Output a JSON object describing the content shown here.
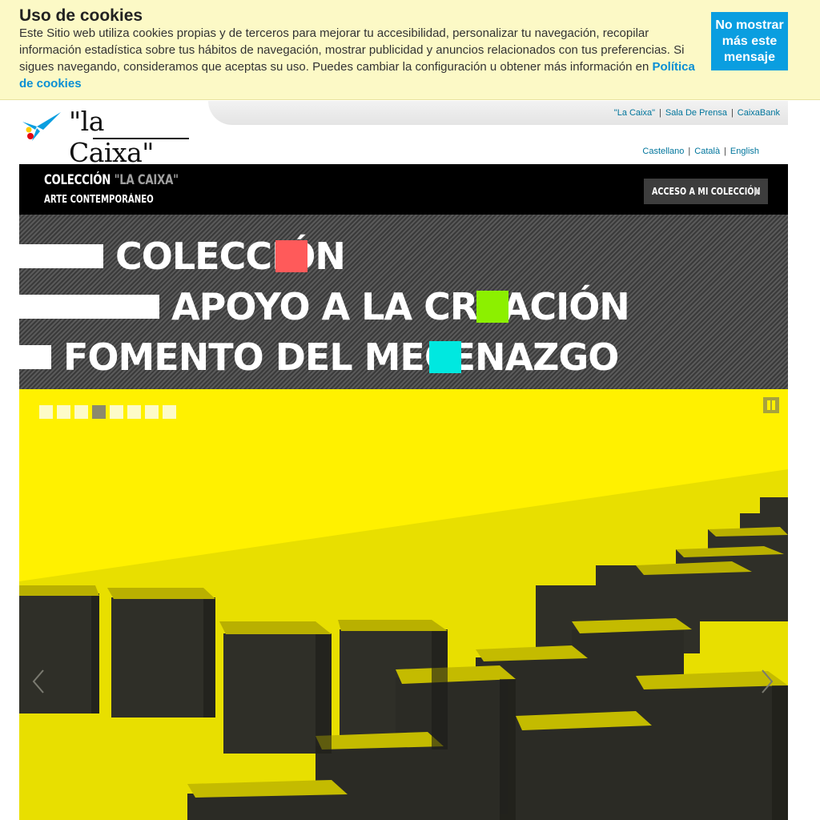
{
  "cookie": {
    "title": "Uso de cookies",
    "text": "Este Sitio web utiliza cookies propias y de terceros para mejorar tu accesibilidad, personalizar tu navegación, recopilar información estadística sobre tus hábitos de navegación, mostrar publicidad y anuncios relacionados con tus preferencias. Si sigues navegando, consideramos que aceptas su uso. Puedes cambiar la configuración u obtener más información en",
    "link": "Política de cookies",
    "button": "No mostrar más este mensaje"
  },
  "header": {
    "logo_text": "\"la Caixa\"",
    "top_links": [
      "\"La Caixa\"",
      "Sala De Prensa",
      "CaixaBank"
    ],
    "languages": [
      "Castellano",
      "Català",
      "English"
    ]
  },
  "collection_bar": {
    "title_white": "COLECCIÓN",
    "title_grey": "\"LA CAIXA\"",
    "subtitle": "ARTE CONTEMPORÁNEO",
    "access_button": "ACCESO A MI COLECCIÓN"
  },
  "menu": [
    {
      "label": "COLECCIÓN",
      "color": "#ff5a5a"
    },
    {
      "label": "APOYO A LA CREACIÓN",
      "color": "#8cf000"
    },
    {
      "label": "FOMENTO DEL MECENAZGO",
      "color": "#00e8e0"
    }
  ],
  "slider": {
    "slide_count": 8,
    "active_slide": 4,
    "background_color": "#fff100",
    "icons": [
      "pause-icon",
      "chevron-left-icon",
      "chevron-right-icon"
    ]
  },
  "colors": {
    "cookie_bg": "#fcf9c6",
    "cookie_button": "#0a9ee0",
    "link_blue": "#00759c",
    "logo_blue": "#0a9ee0"
  }
}
